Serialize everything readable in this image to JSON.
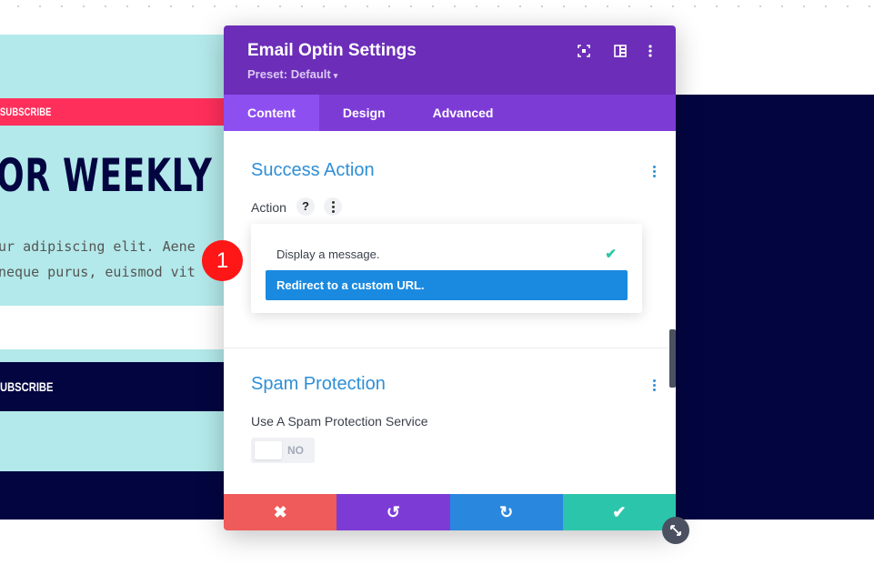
{
  "background": {
    "pink_button": "SUBSCRIBE",
    "headline": "OR WEEKLY DE",
    "mono_line1": "ur adipiscing elit. Aene",
    "mono_line2": "neque purus, euismod vit",
    "navy_button": "UBSCRIBE",
    "colors": {
      "cyan": "#b3e9ea",
      "navy": "#030541",
      "pink": "#ff2f5b"
    }
  },
  "step_badge": "1",
  "modal": {
    "title": "Email Optin Settings",
    "preset": "Preset: Default",
    "header_icons": [
      "fullscreen-icon",
      "split-view-icon",
      "more-icon"
    ],
    "tabs": [
      {
        "label": "Content",
        "active": true
      },
      {
        "label": "Design",
        "active": false
      },
      {
        "label": "Advanced",
        "active": false
      }
    ],
    "success_action": {
      "title": "Success Action",
      "field_label": "Action",
      "help_glyph": "?",
      "options": [
        {
          "label": "Display a message.",
          "checked": true
        },
        {
          "label": "Redirect to a custom URL.",
          "highlighted": true
        }
      ]
    },
    "spam_protection": {
      "title": "Spam Protection",
      "field_label": "Use A Spam Protection Service",
      "toggle_value": "NO"
    },
    "footer": {
      "cancel_glyph": "✖",
      "undo_glyph": "↺",
      "redo_glyph": "↻",
      "save_glyph": "✔"
    },
    "colors": {
      "header": "#6c2eb9",
      "tabs": "#7d3bd6",
      "accent_blue": "#2e8fd6",
      "save_green": "#2bc5ab",
      "cancel_red": "#ef5a5a"
    }
  }
}
